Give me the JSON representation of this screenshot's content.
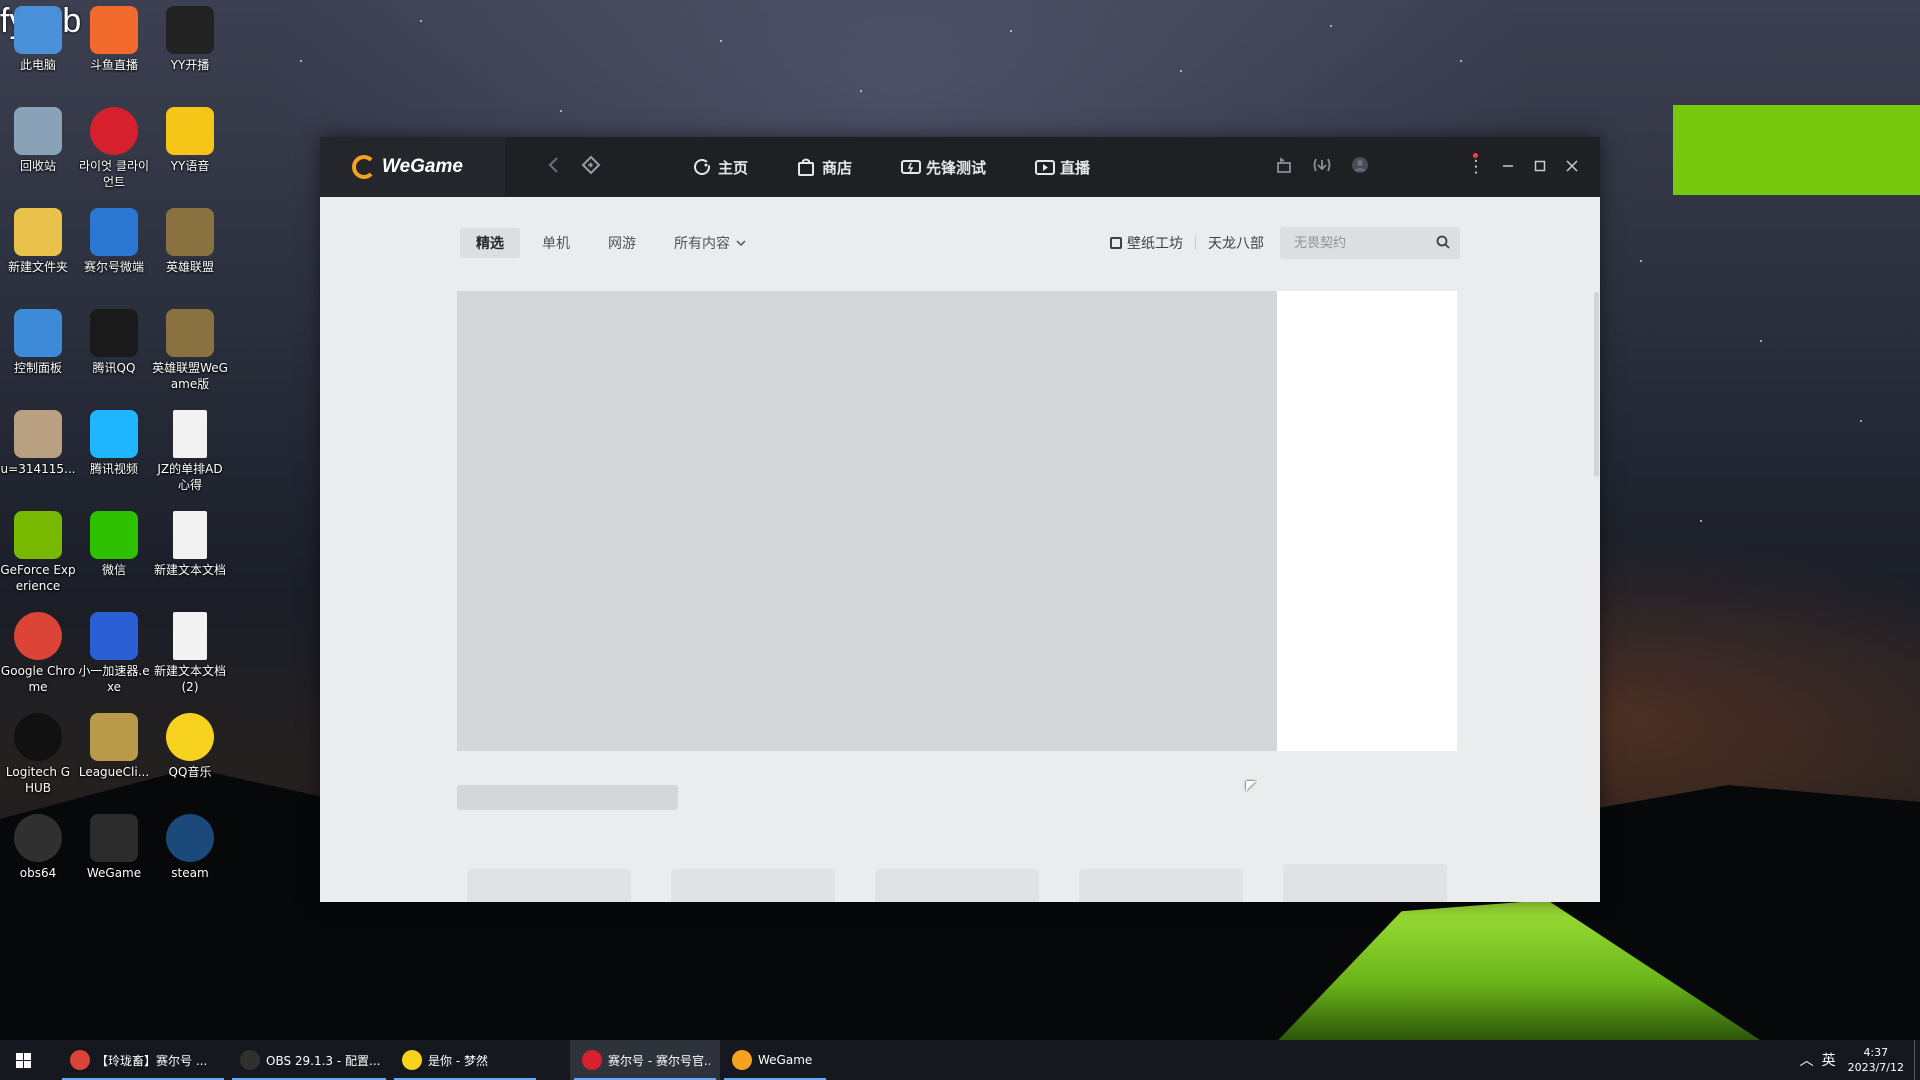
{
  "desktop": {
    "overlay_text": "fyynb",
    "icons": [
      {
        "label": "此电脑",
        "icon": "computer-icon",
        "color": "#4a90d9"
      },
      {
        "label": "斗鱼直播",
        "icon": "douyu-icon",
        "color": "#f26a2e"
      },
      {
        "label": "YY开播",
        "icon": "yy-live-icon",
        "color": "#222222"
      },
      {
        "label": "回收站",
        "icon": "recycle-bin-icon",
        "color": "#8aa2b8"
      },
      {
        "label": "라이엇 클라이언트",
        "icon": "riot-client-icon",
        "color": "#d6202d"
      },
      {
        "label": "YY语音",
        "icon": "yy-voice-icon",
        "color": "#f5c518"
      },
      {
        "label": "新建文件夹",
        "icon": "folder-icon",
        "color": "#e8c24a"
      },
      {
        "label": "赛尔号微端",
        "icon": "seer-icon",
        "color": "#2a78d2"
      },
      {
        "label": "英雄联盟",
        "icon": "lol-icon",
        "color": "#8a7240"
      },
      {
        "label": "控制面板",
        "icon": "control-panel-icon",
        "color": "#3c8ad8"
      },
      {
        "label": "腾讯QQ",
        "icon": "qq-icon",
        "color": "#1a1a1a"
      },
      {
        "label": "英雄联盟WeGame版",
        "icon": "lol-wegame-icon",
        "color": "#8a7240"
      },
      {
        "label": "u=314115...",
        "icon": "image-file-icon",
        "color": "#b8a080"
      },
      {
        "label": "腾讯视频",
        "icon": "tencent-video-icon",
        "color": "#1fb6ff"
      },
      {
        "label": "JZ的单排AD心得",
        "icon": "text-file-icon",
        "color": "#f2f2f2"
      },
      {
        "label": "GeForce Experience",
        "icon": "nvidia-icon",
        "color": "#76b900"
      },
      {
        "label": "微信",
        "icon": "wechat-icon",
        "color": "#2dc100"
      },
      {
        "label": "新建文本文档",
        "icon": "text-file-icon",
        "color": "#f2f2f2"
      },
      {
        "label": "Google Chrome",
        "icon": "chrome-icon",
        "color": "#db4437"
      },
      {
        "label": "小一加速器.exe",
        "icon": "accelerator-icon",
        "color": "#2a5fd6"
      },
      {
        "label": "新建文本文档 (2)",
        "icon": "text-file-icon",
        "color": "#f2f2f2"
      },
      {
        "label": "Logitech G HUB",
        "icon": "logitech-icon",
        "color": "#111111"
      },
      {
        "label": "LeagueCli...",
        "icon": "league-client-icon",
        "color": "#b89a4a"
      },
      {
        "label": "QQ音乐",
        "icon": "qq-music-icon",
        "color": "#f7d21e"
      },
      {
        "label": "obs64",
        "icon": "obs-icon",
        "color": "#303030"
      },
      {
        "label": "WeGame",
        "icon": "wegame-icon",
        "color": "#2b2b2b"
      },
      {
        "label": "steam",
        "icon": "steam-icon",
        "color": "#1b4a7a"
      }
    ]
  },
  "wegame": {
    "logo_text": "WeGame",
    "tabs": [
      {
        "label": "主页",
        "icon": "home-icon"
      },
      {
        "label": "商店",
        "icon": "store-icon"
      },
      {
        "label": "先锋测试",
        "icon": "pioneer-test-icon"
      },
      {
        "label": "直播",
        "icon": "live-icon"
      }
    ],
    "subtabs": [
      {
        "label": "精选",
        "active": true
      },
      {
        "label": "单机",
        "active": false
      },
      {
        "label": "网游",
        "active": false
      },
      {
        "label": "所有内容",
        "active": false
      }
    ],
    "links": {
      "wallpaper": "壁纸工坊",
      "game": "天龙八部"
    },
    "search": {
      "placeholder": "无畏契约"
    }
  },
  "taskbar": {
    "items": [
      {
        "label": "【玲珑畜】赛尔号 ...",
        "icon": "chrome-icon",
        "color": "#db4437",
        "active": false
      },
      {
        "label": "OBS 29.1.3 - 配置...",
        "icon": "obs-icon",
        "color": "#303030",
        "active": false
      },
      {
        "label": "是你 - 梦然",
        "icon": "qq-music-icon",
        "color": "#f7d21e",
        "active": false
      },
      {
        "label": "赛尔号 - 赛尔号官...",
        "icon": "seer-icon",
        "color": "#d6202d",
        "active": true
      },
      {
        "label": "WeGame",
        "icon": "wegame-icon",
        "color": "#f6a21e",
        "active": false
      }
    ],
    "tray": {
      "ime": "英",
      "time": "4:37",
      "date": "2023/7/12"
    }
  }
}
